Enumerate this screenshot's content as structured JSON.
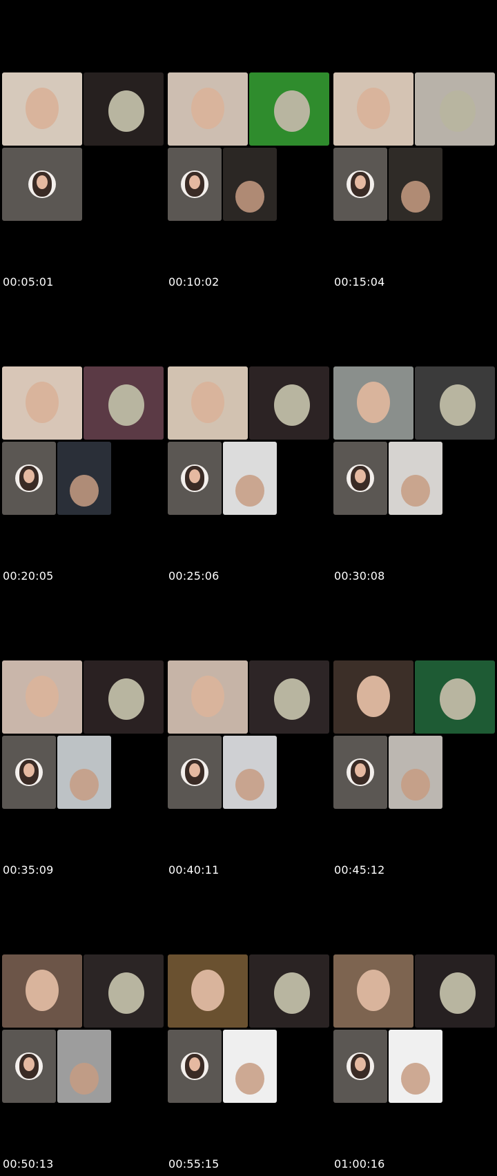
{
  "grid": {
    "cells": [
      {
        "time": "00:05:01",
        "b1": "#d6c9bb",
        "b2": "#26201f",
        "s2": "none"
      },
      {
        "time": "00:10:02",
        "b1": "#cdbeb1",
        "b2": "#2f8c2d",
        "s2": "#2b2724"
      },
      {
        "time": "00:15:04",
        "b1": "#d4c3b3",
        "b2": "#b8b2a9",
        "s2": "#2f2b27"
      },
      {
        "time": "00:20:05",
        "b1": "#d8c6b7",
        "b2": "#5b3a45",
        "s2": "#2a2f38"
      },
      {
        "time": "00:25:06",
        "b1": "#d2c2b1",
        "b2": "#2c2324",
        "s2": "#dcdcdc"
      },
      {
        "time": "00:30:08",
        "b1": "#8a8f8c",
        "b2": "#3b3b3b",
        "s2": "#d6d3d0"
      },
      {
        "time": "00:35:09",
        "b1": "#c9b6aa",
        "b2": "#2a2122",
        "s2": "#bdc2c5"
      },
      {
        "time": "00:40:11",
        "b1": "#c6b4a7",
        "b2": "#2d2526",
        "s2": "#cfd0d3"
      },
      {
        "time": "00:45:12",
        "b1": "#3c2f28",
        "b2": "#1e5b34",
        "s2": "#bcb7b1"
      },
      {
        "time": "00:50:13",
        "b1": "#6c5548",
        "b2": "#2b2525",
        "s2": "#9d9d9d"
      },
      {
        "time": "00:55:15",
        "b1": "#6a5130",
        "b2": "#2a2323",
        "s2": "#efefef"
      },
      {
        "time": "01:00:16",
        "b1": "#7d6450",
        "b2": "#262021",
        "s2": "#f0f0f0"
      }
    ]
  }
}
